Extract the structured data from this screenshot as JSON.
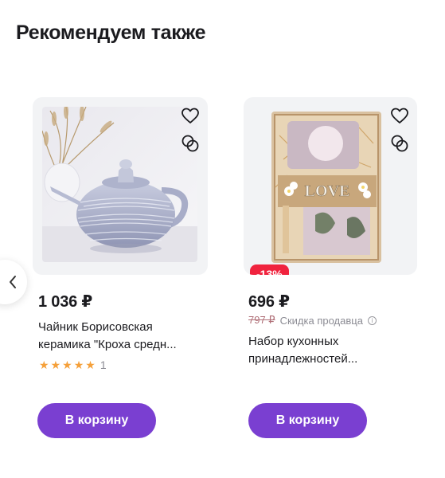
{
  "section": {
    "title": "Рекомендуем также"
  },
  "colors": {
    "accent": "#7a3fd1",
    "discount": "#f0233e",
    "star": "#f5a03a"
  },
  "products": [
    {
      "price": "1 036 ₽",
      "title_line1": "Чайник Борисовская",
      "title_line2": "керамика \"Кроха средн...",
      "rating_stars": 5,
      "rating_count": "1",
      "cart_label": "В корзину"
    },
    {
      "discount": "-13%",
      "price": "696 ₽",
      "old_price": "797 ₽",
      "seller_discount_label": "Скидка продавца",
      "title_line1": "Набор кухонных",
      "title_line2": "принадлежностей...",
      "cart_label": "В корзину",
      "package_text": "LOVE"
    }
  ],
  "icons": [
    "chevron-left-icon",
    "heart-icon",
    "compare-icon",
    "star-icon",
    "info-icon"
  ]
}
